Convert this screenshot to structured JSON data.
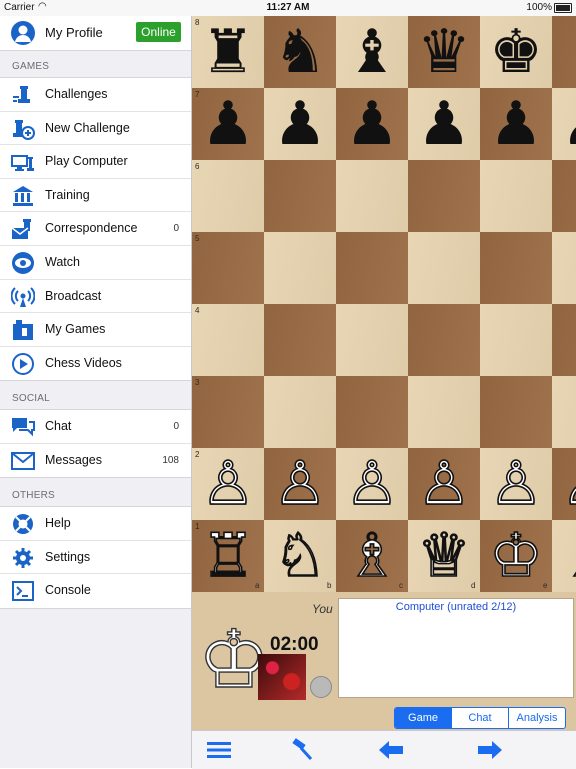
{
  "status_bar": {
    "carrier": "Carrier",
    "time": "11:27 AM",
    "battery": "100%"
  },
  "sidebar": {
    "profile": {
      "label": "My Profile",
      "status": "Online"
    },
    "sections": [
      {
        "title": "GAMES",
        "items": [
          {
            "label": "Challenges",
            "icon": "challenges-icon"
          },
          {
            "label": "New Challenge",
            "icon": "new-challenge-icon"
          },
          {
            "label": "Play Computer",
            "icon": "play-computer-icon"
          },
          {
            "label": "Training",
            "icon": "training-icon"
          },
          {
            "label": "Correspondence",
            "icon": "correspondence-icon",
            "count": "0"
          },
          {
            "label": "Watch",
            "icon": "watch-icon"
          },
          {
            "label": "Broadcast",
            "icon": "broadcast-icon"
          },
          {
            "label": "My Games",
            "icon": "my-games-icon"
          },
          {
            "label": "Chess Videos",
            "icon": "chess-videos-icon"
          }
        ]
      },
      {
        "title": "SOCIAL",
        "items": [
          {
            "label": "Chat",
            "icon": "chat-icon",
            "count": "0"
          },
          {
            "label": "Messages",
            "icon": "messages-icon",
            "count": "108"
          }
        ]
      },
      {
        "title": "OTHERS",
        "items": [
          {
            "label": "Help",
            "icon": "help-icon"
          },
          {
            "label": "Settings",
            "icon": "settings-icon"
          },
          {
            "label": "Console",
            "icon": "console-icon"
          }
        ]
      }
    ]
  },
  "board": {
    "rank_labels": [
      "8",
      "7",
      "6",
      "5",
      "4",
      "3",
      "2",
      "1"
    ],
    "file_labels": [
      "a",
      "b",
      "c",
      "d",
      "e"
    ],
    "pieces": {
      "8": [
        "♜",
        "♞",
        "♝",
        "♛",
        "♚",
        ""
      ],
      "7": [
        "♟",
        "♟",
        "♟",
        "♟",
        "♟",
        "♟"
      ],
      "2": [
        "♙",
        "♙",
        "♙",
        "♙",
        "♙",
        "♙"
      ],
      "1": [
        "♖",
        "♘",
        "♗",
        "♕",
        "♔",
        "♗"
      ]
    }
  },
  "game_panel": {
    "player_label": "You",
    "clock": "02:00",
    "opponent": "Computer (unrated  2/12)",
    "tabs": [
      "Game",
      "Chat",
      "Analysis"
    ]
  },
  "toolbar": {
    "icons": [
      "menu-icon",
      "hammer-icon",
      "back-arrow-icon",
      "forward-arrow-icon"
    ]
  },
  "colors": {
    "accent": "#1a6cf0",
    "online": "#2ca02c",
    "board_light": "#e6d2ae",
    "board_dark": "#9a6b43"
  }
}
